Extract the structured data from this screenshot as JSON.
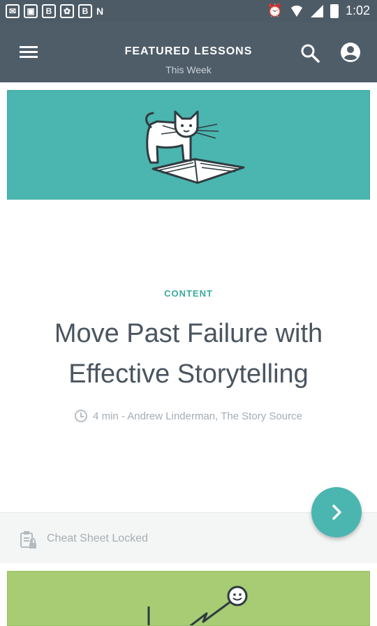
{
  "status_bar": {
    "time": "1:02",
    "left_icons": [
      "mail-icon",
      "image-icon",
      "bold-b-icon",
      "settings-icon",
      "bold-b-icon",
      "n-icon"
    ],
    "right_icons": [
      "alarm-icon",
      "wifi-icon",
      "signal-icon",
      "battery-icon"
    ]
  },
  "app_bar": {
    "title": "FEATURED LESSONS",
    "subtitle": "This Week",
    "menu_icon": "hamburger-menu-icon",
    "search_icon": "search-icon",
    "account_icon": "account-circle-icon",
    "background_color": "#4f5d69"
  },
  "lesson": {
    "category": "CONTENT",
    "title": "Move Past Failure with Effective Storytelling",
    "meta": "4 min - Andrew Linderman, The Story Source",
    "image_color": "#4bb5b0"
  },
  "cheat_sheet": {
    "label": "Cheat Sheet Locked",
    "icon": "locked-clipboard-icon"
  },
  "fab": {
    "icon": "chevron-right-icon",
    "color": "#4bb5b0"
  },
  "next_card": {
    "image_color": "#a7cc74"
  }
}
